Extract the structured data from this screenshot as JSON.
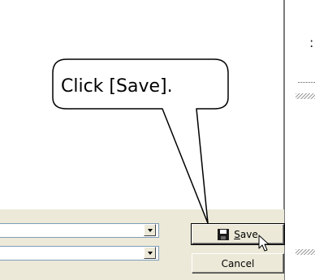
{
  "callout": {
    "text": "Click [Save]."
  },
  "buttons": {
    "save_label": "Save",
    "save_accel": "S",
    "cancel_label": "Cancel"
  },
  "icons": {
    "save": "floppy-disk-icon",
    "cursor": "mouse-pointer-icon",
    "dropdown": "dropdown-arrow-icon"
  },
  "misc": {
    "colon": ":"
  }
}
